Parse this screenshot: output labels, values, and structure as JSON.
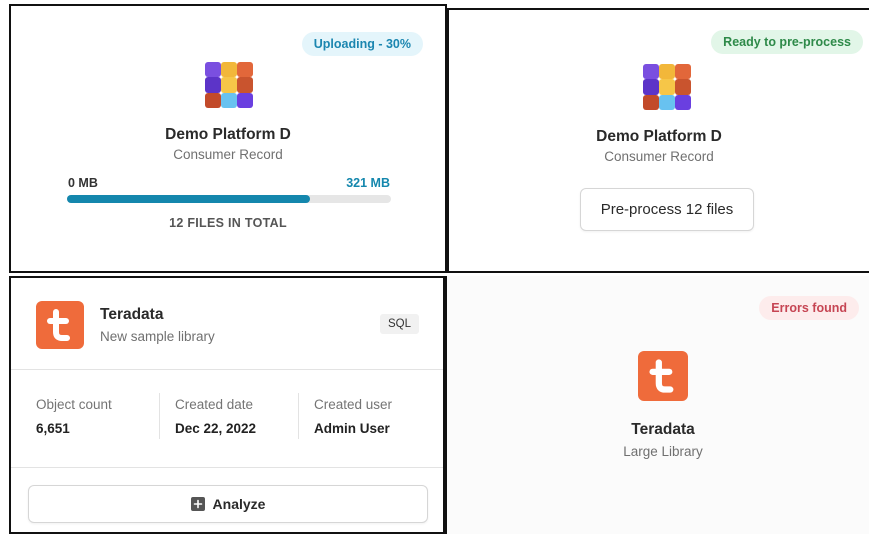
{
  "cards": {
    "uploading": {
      "status": "Uploading - 30%",
      "title": "Demo Platform D",
      "subtitle": "Consumer Record",
      "progress_start": "0 MB",
      "progress_end": "321 MB",
      "progress_fraction": 0.75,
      "files_total": "12 FILES IN TOTAL",
      "icon": "cube-icon"
    },
    "ready": {
      "status": "Ready to pre-process",
      "title": "Demo Platform D",
      "subtitle": "Consumer Record",
      "button_label": "Pre-process 12 files",
      "icon": "cube-icon"
    },
    "library": {
      "title": "Teradata",
      "subtitle": "New sample library",
      "tag": "SQL",
      "icon": "teradata-logo-icon",
      "meta": [
        {
          "label": "Object count",
          "value": "6,651"
        },
        {
          "label": "Created date",
          "value": "Dec 22, 2022"
        },
        {
          "label": "Created user",
          "value": "Admin User"
        }
      ],
      "button_label": "Analyze",
      "button_icon": "plus-square-icon"
    },
    "errors": {
      "status": "Errors found",
      "title": "Teradata",
      "subtitle": "Large Library",
      "icon": "teradata-logo-icon"
    }
  },
  "colors": {
    "accent_blue": "#1487ad",
    "teradata_orange": "#ef6b3b",
    "success_green": "#2e8a49",
    "error_red": "#c64553"
  }
}
